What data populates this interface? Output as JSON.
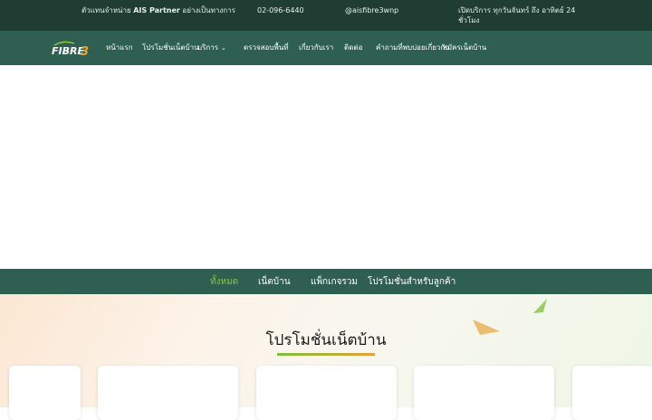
{
  "topbar": {
    "partner_prefix": "ตัวแทนจำหน่าย",
    "partner_name": "AIS Partner",
    "partner_suffix": "อย่างเป็นทางการ",
    "phone": "02-096-6440",
    "line_id": "@aisfibre3wnp",
    "hours": "เปิดบริการ ทุกวันจันทร์ ถึง อาทิตย์ 24 ชั่วโมง"
  },
  "brand": {
    "logo_text": "FIBRE3",
    "logo_accent_color": "#8cc63f",
    "logo_3_color": "#e8a23a"
  },
  "nav": {
    "items": [
      {
        "label": "หน้าแรก"
      },
      {
        "label": "โปรโมชั่นเน็ตบ้าน"
      },
      {
        "label": "บริการ",
        "has_dropdown": true
      },
      {
        "label": "ตรวจสอบพื้นที่"
      },
      {
        "label": "เกี่ยวกับเรา"
      },
      {
        "label": "ติดต่อ"
      },
      {
        "label": "คำถามที่พบบ่อยเกี่ยวกับ"
      },
      {
        "label": "สมัครเน็ตบ้าน"
      }
    ]
  },
  "subnav": {
    "items": [
      {
        "label": "ทั้งหมด",
        "active": true
      },
      {
        "label": "เน็ตบ้าน",
        "active": false
      },
      {
        "label": "แพ็กเกจรวม",
        "active": false
      },
      {
        "label": "โปรโมชั่นสำหรับลูกค้า",
        "active": false
      }
    ]
  },
  "section": {
    "title": "โปรโมชั่นเน็ตบ้าน"
  },
  "colors": {
    "topbar_bg": "#1f3d33",
    "nav_bg": "#2e5f50",
    "active_tab": "#8cc63f",
    "decor_orange": "#e8a23a",
    "decor_green": "#7cbf3a"
  }
}
